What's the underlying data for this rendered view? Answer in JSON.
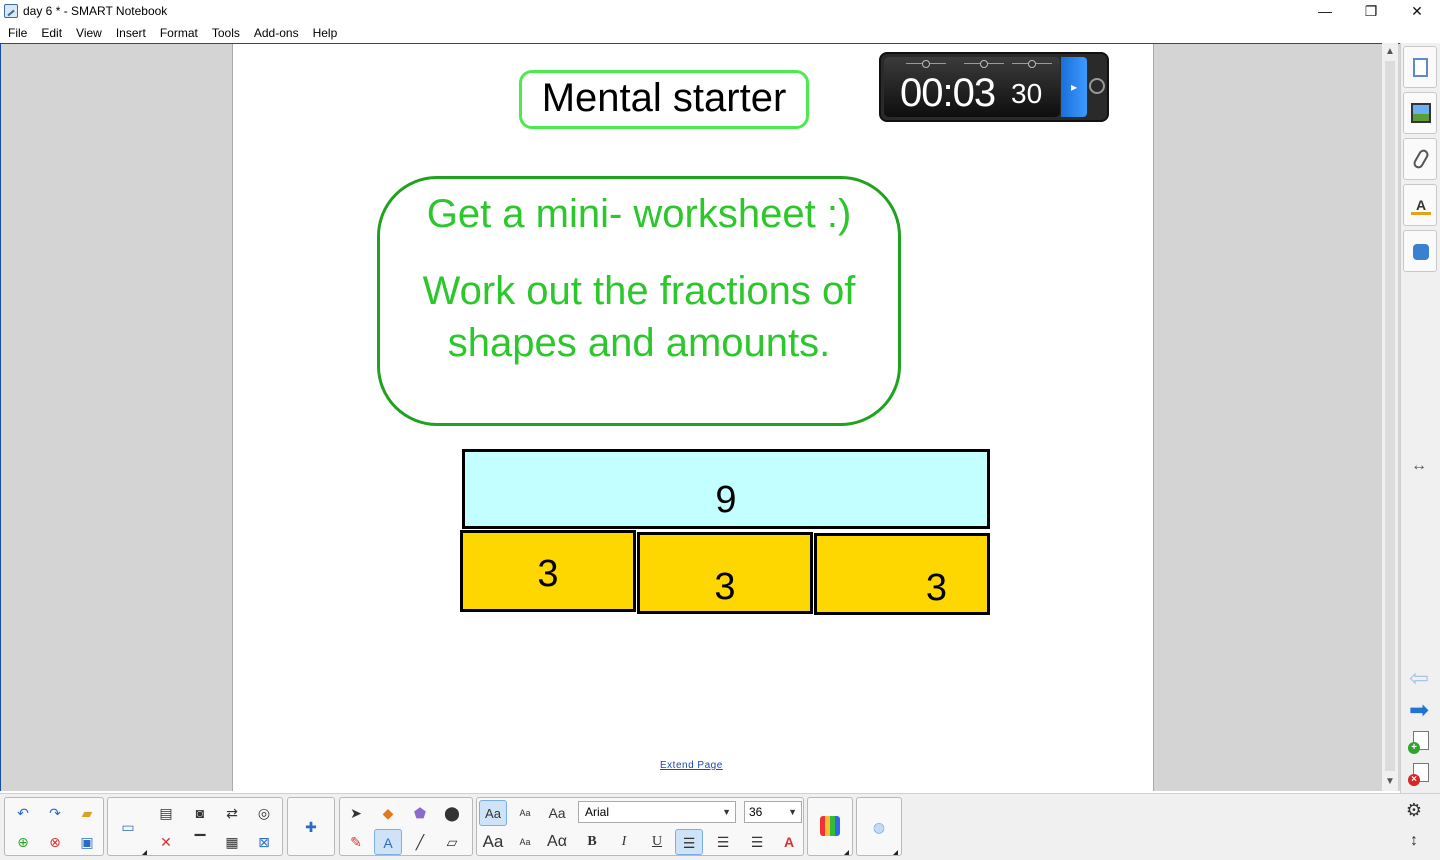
{
  "window": {
    "title": "day 6 * - SMART Notebook",
    "controls": {
      "minimize": "—",
      "maximize": "❐",
      "close": "✕"
    }
  },
  "menu": [
    "File",
    "Edit",
    "View",
    "Insert",
    "Format",
    "Tools",
    "Add-ons",
    "Help"
  ],
  "slide": {
    "title": "Mental starter",
    "timer": {
      "display": "00:03",
      "seconds": "30",
      "play_symbol": "▸"
    },
    "instructions": {
      "line1": "Get a mini- worksheet :)",
      "line2a": "Work out the fractions of",
      "line2b": "shapes and amounts."
    },
    "bar_model": {
      "whole": "9",
      "parts": [
        "3",
        "3",
        "3"
      ],
      "whole_color": "#c4ffff",
      "part_color": "#ffd700"
    },
    "extend_link": "Extend Page"
  },
  "colors": {
    "title_border": "#4dea4d",
    "instruction_text": "#2bc72b",
    "instruction_border": "#1fa31f",
    "accent_blue": "#1d74d4"
  },
  "sidebar": {
    "tabs": [
      "page-sorter-icon",
      "gallery-icon",
      "attachments-icon",
      "properties-icon",
      "add-ons-icon"
    ],
    "properties_glyph": "A",
    "resize_glyph": "↔",
    "prev_glyph": "⇦",
    "next_glyph": "➡",
    "add_badge": "+",
    "delete_badge": "×"
  },
  "toolbar": {
    "font_name": "Arial",
    "font_size": "36",
    "text_buttons": {
      "style_large": "Aa",
      "style_small": "Aa",
      "style_serif": "Aa",
      "aa_large_2": "Aa",
      "aa_small_2": "Aa",
      "aa_serif_2": "Aα",
      "bold": "B",
      "italic": "I",
      "underline": "U",
      "text_color": "A",
      "clear_format": "A"
    },
    "settings_glyph": "⚙",
    "move_glyph": "↕"
  }
}
